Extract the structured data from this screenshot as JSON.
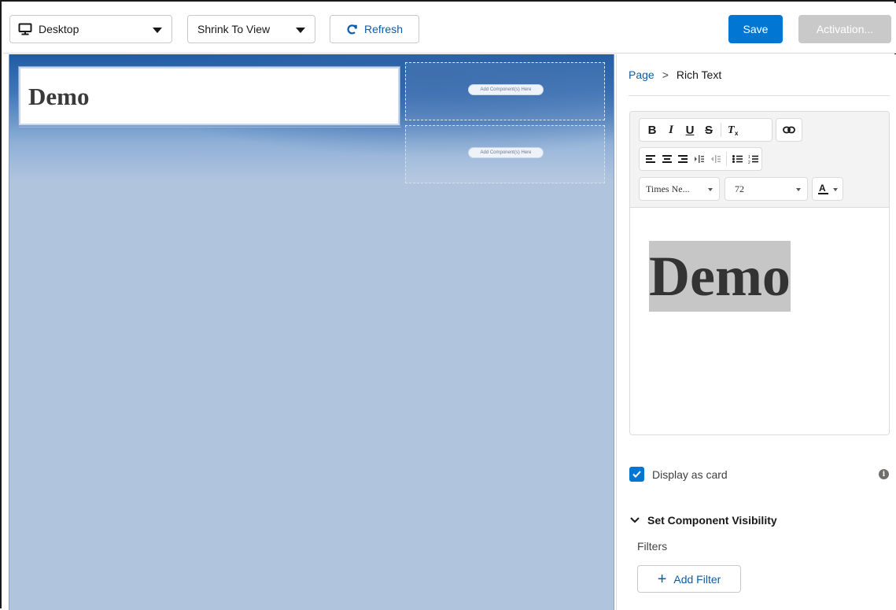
{
  "toolbar": {
    "device_select": {
      "value": "Desktop",
      "icon": "monitor-icon"
    },
    "zoom_select": {
      "value": "Shrink To View"
    },
    "refresh_label": "Refresh",
    "save_label": "Save",
    "activation_label": "Activation..."
  },
  "canvas": {
    "rich_text_content": "Demo",
    "placeholder_1": "Add Component(s) Here",
    "placeholder_2": "Add Component(s) Here",
    "background_color": "#b0c4de"
  },
  "panel": {
    "breadcrumb": {
      "root": "Page",
      "separator": ">",
      "current": "Rich Text"
    },
    "editor": {
      "font_family": "Times Ne...",
      "font_size": "72",
      "content": "Demo",
      "format_buttons": [
        "B",
        "I",
        "U",
        "S",
        "Tx"
      ],
      "align_buttons": [
        "align-left",
        "align-center",
        "align-right",
        "indent",
        "outdent",
        "bullet-list",
        "numbered-list"
      ]
    },
    "display_as_card": {
      "label": "Display as card",
      "checked": true
    },
    "visibility_section": {
      "label": "Set Component Visibility",
      "expanded": true
    },
    "filters_label": "Filters",
    "add_filter_label": "Add Filter"
  },
  "colors": {
    "brand": "#0176d3",
    "link": "#0b5cab",
    "disabled_button": "#c9c9c9"
  }
}
